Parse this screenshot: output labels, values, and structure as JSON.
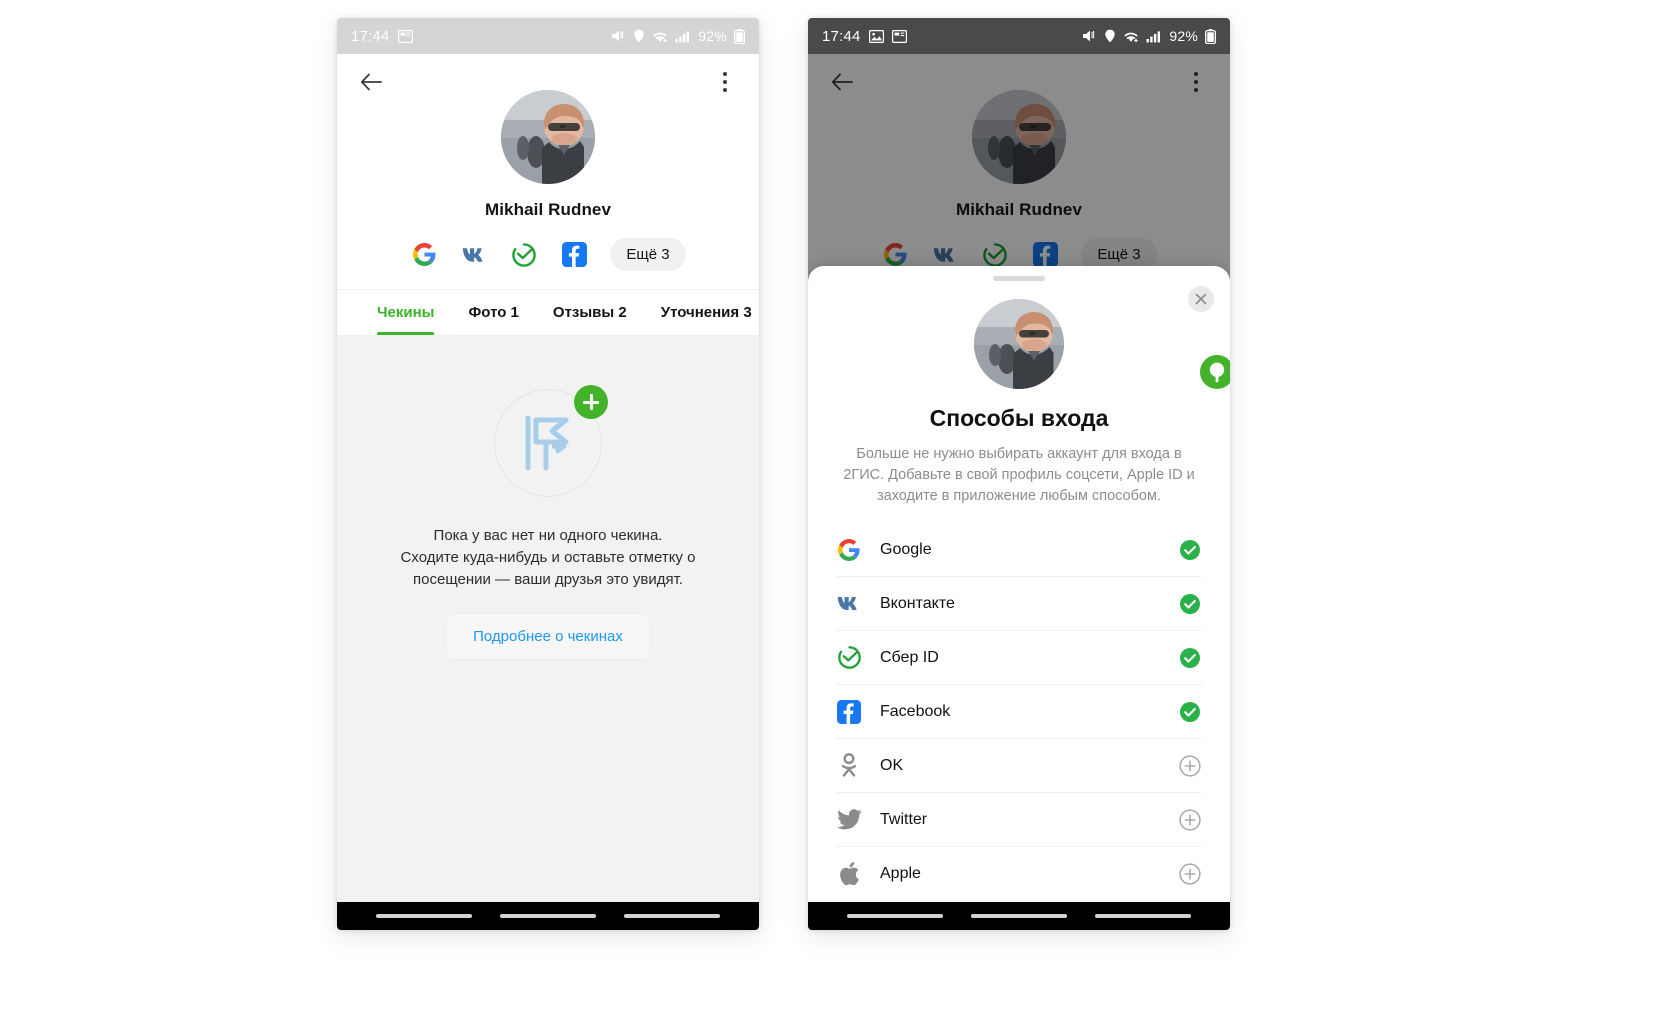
{
  "status_bar": {
    "time": "17:44",
    "battery": "92%",
    "left_icons": [
      "image-icon",
      "card-icon"
    ],
    "right_icons": [
      "mute-icon",
      "location-icon",
      "wifi-icon",
      "signal-icon",
      "battery-icon"
    ]
  },
  "profile": {
    "name": "Mikhail Rudnev",
    "back_label": "back-arrow",
    "menu_label": "more-options",
    "socials": [
      "google",
      "vk",
      "sber",
      "facebook"
    ],
    "more_chip": "Ещё 3"
  },
  "tabs": [
    {
      "label": "Чекины",
      "active": true
    },
    {
      "label": "Фото 1",
      "active": false
    },
    {
      "label": "Отзывы 2",
      "active": false
    },
    {
      "label": "Уточнения 3",
      "active": false
    }
  ],
  "empty_state": {
    "line1": "Пока у вас нет ни одного чекина.",
    "line2": "Сходите куда-нибудь и оставьте отметку о",
    "line3": "посещении — ваши друзья это увидят.",
    "button": "Подробнее о чекинах"
  },
  "sheet": {
    "title": "Способы входа",
    "description": "Больше не нужно выбирать аккаунт для входа в 2ГИС. Добавьте в свой профиль соцсети, Apple ID и заходите в приложение любым способом.",
    "close_label": "×",
    "methods": [
      {
        "name": "Google",
        "icon": "google-icon",
        "state": "connected"
      },
      {
        "name": "Вконтакте",
        "icon": "vk-icon",
        "state": "connected"
      },
      {
        "name": "Сбер ID",
        "icon": "sber-icon",
        "state": "connected"
      },
      {
        "name": "Facebook",
        "icon": "facebook-icon",
        "state": "connected"
      },
      {
        "name": "OK",
        "icon": "odnoklassniki-icon",
        "state": "add"
      },
      {
        "name": "Twitter",
        "icon": "twitter-icon",
        "state": "add"
      },
      {
        "name": "Apple",
        "icon": "apple-icon",
        "state": "add"
      }
    ]
  },
  "colors": {
    "accent_green": "#3cb52b",
    "link_blue": "#2196f3",
    "check_green": "#37b34a",
    "status_light": "#d5d5d5",
    "status_dark": "#4a4a4a"
  }
}
